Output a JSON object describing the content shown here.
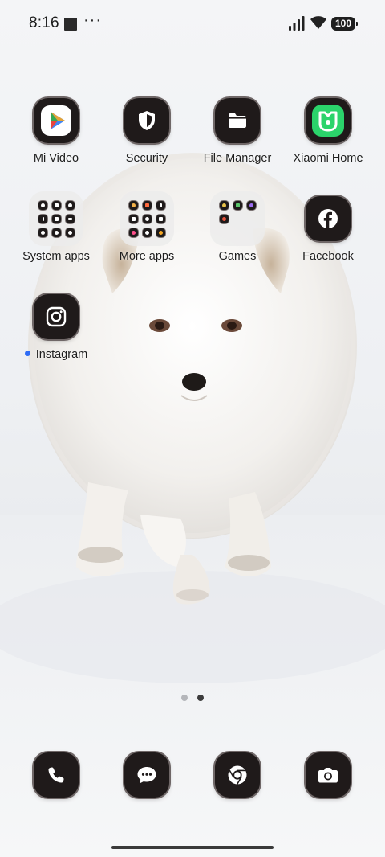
{
  "status_bar": {
    "time": "8:16",
    "more_indicator": "···",
    "battery_level": "100",
    "icons": [
      "notification-square-icon",
      "signal-icon",
      "wifi-icon",
      "battery-icon"
    ]
  },
  "apps": {
    "mi_video": {
      "label": "Mi Video",
      "icon": "mi-video-icon"
    },
    "security": {
      "label": "Security",
      "icon": "shield-icon"
    },
    "file_manager": {
      "label": "File Manager",
      "icon": "folder-icon"
    },
    "xiaomi_home": {
      "label": "Xiaomi Home",
      "icon": "xiaomi-home-icon"
    },
    "system_apps": {
      "label": "System apps",
      "icon": "folder-system-apps"
    },
    "more_apps": {
      "label": "More apps",
      "icon": "folder-more-apps"
    },
    "games": {
      "label": "Games",
      "icon": "folder-games"
    },
    "facebook": {
      "label": "Facebook",
      "icon": "facebook-icon"
    },
    "instagram": {
      "label": "Instagram",
      "icon": "instagram-icon",
      "new_badge_color": "#2f6cf5"
    }
  },
  "page_indicator": {
    "pages": 2,
    "current": 2
  },
  "dock": {
    "items": [
      {
        "name": "Phone",
        "icon": "phone-icon"
      },
      {
        "name": "Messaging",
        "icon": "messages-icon"
      },
      {
        "name": "Chrome",
        "icon": "chrome-icon"
      },
      {
        "name": "Camera",
        "icon": "camera-icon"
      }
    ]
  },
  "colors": {
    "tile_background": "#1f1a1a",
    "tile_border": "#6f6767",
    "mi_video_play": [
      "#f5a623",
      "#e8453c",
      "#4285f4",
      "#34a853"
    ],
    "xiaomi_home_green": "#2bd46b",
    "gesture_bar": "#3a3a3a"
  }
}
